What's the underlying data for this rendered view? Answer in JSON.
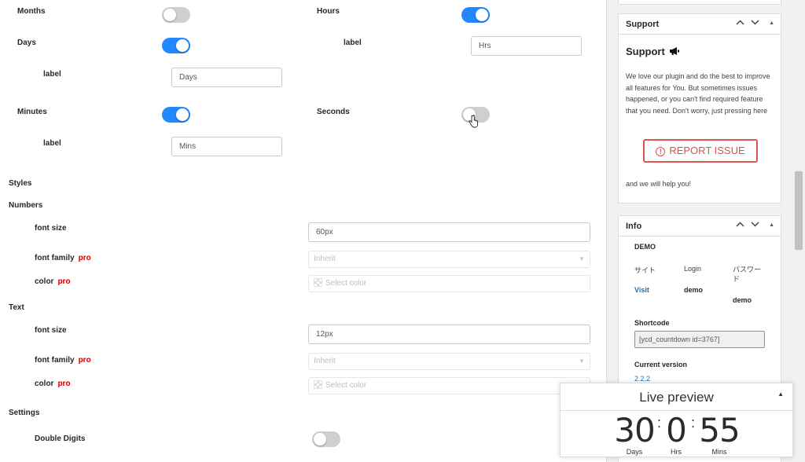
{
  "main": {
    "labels": {
      "months": "Months",
      "hours": "Hours",
      "hours_label": "label",
      "days": "Days",
      "days_label": "label",
      "minutes": "Minutes",
      "seconds": "Seconds",
      "minutes_label": "label",
      "styles": "Styles",
      "numbers": "Numbers",
      "numbers_font_size": "font size",
      "numbers_font_family": "font family",
      "numbers_color": "color",
      "text": "Text",
      "text_font_size": "font size",
      "text_font_family": "font family",
      "text_color": "color",
      "settings": "Settings",
      "double_digits": "Double Digits",
      "pro": "pro"
    },
    "toggles": {
      "months": false,
      "hours": true,
      "days": true,
      "minutes": true,
      "seconds": false,
      "double_digits": false
    },
    "inputs": {
      "hours_label": "Hrs",
      "days_label": "Days",
      "minutes_label": "Mins",
      "numbers_font_size": "60px",
      "numbers_font_family": "Inherit",
      "numbers_color_placeholder": "Select color",
      "text_font_size": "12px",
      "text_font_family": "Inherit",
      "text_color_placeholder": "Select color"
    }
  },
  "sidebar": {
    "support": {
      "title": "Support",
      "heading": "Support",
      "icon": "megaphone-icon",
      "body": "We love our plugin and do the best to improve all features for You. But sometimes issues happened, or you can't find required feature that you need. Don't worry, just pressing here",
      "button": "REPORT ISSUE",
      "footer": "and we will help you!"
    },
    "info": {
      "title": "Info",
      "demo": "DEMO",
      "col_site": "サイト",
      "col_login": "Login",
      "col_password": "パスワード",
      "site_link": "Visit",
      "login_value": "demo",
      "password_value": "demo",
      "shortcode_label": "Shortcode",
      "shortcode_value": "[ycd_countdown id=3767]",
      "version_label": "Current version",
      "version_value": "2.2.2"
    }
  },
  "preview": {
    "title": "Live preview",
    "days": "30",
    "hours": "0",
    "minutes": "55",
    "days_label": "Days",
    "hours_label": "Hrs",
    "minutes_label": "Mins"
  },
  "colors": {
    "toggle_on": "#2188ff",
    "toggle_off": "#cfcfcf",
    "pro": "#cc0000",
    "report": "#d9534f",
    "link": "#2271b1"
  }
}
